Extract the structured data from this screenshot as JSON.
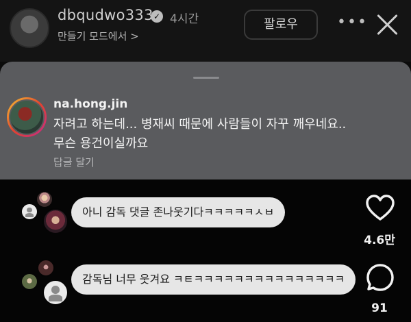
{
  "header": {
    "username": "dbqudwo333",
    "time": "4시간",
    "subtitle": "만들기 모드에서 >",
    "follow_label": "팔로우",
    "more_label": "•••"
  },
  "sheet_comment": {
    "username": "na.hong.jin",
    "text": "자려고 하는데... 병재씨 때문에 사람들이 자꾸 깨우네요.. 무슨 용건이실까요",
    "reply_label": "답글 달기"
  },
  "live_comments": [
    {
      "text": "아니 감독 댓글 존나웃기다ㅋㅋㅋㅋㅋㅅㅂ"
    },
    {
      "text": "감독님 너무 웃겨요 ㅋㅌㅋㅋㅋㅋㅋㅋㅋㅋㅋㅋㅋㅋㅋㅋㅋ"
    }
  ],
  "actions": {
    "likes_count": "4.6만",
    "comments_count": "91"
  },
  "colors": {
    "sheet_bg": "#5a5b5e",
    "bubble_bg": "#e6e6e6",
    "background": "#0b0b0b"
  }
}
